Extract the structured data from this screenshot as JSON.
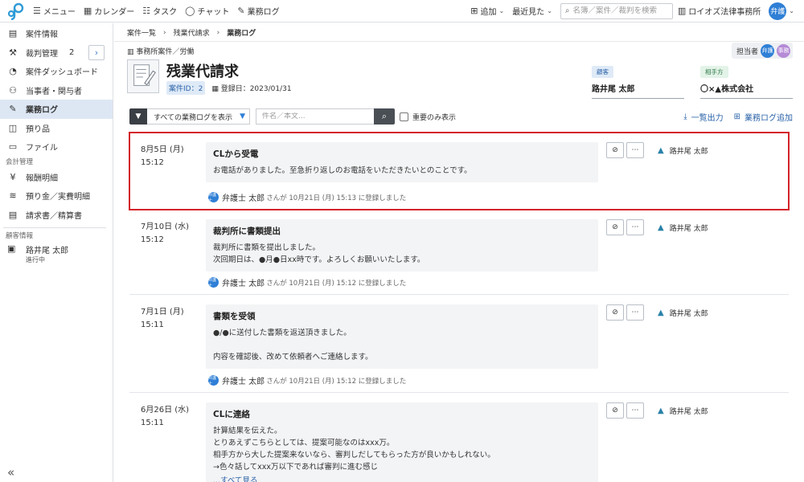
{
  "topbar": {
    "nav": [
      {
        "icon": "hamburger-icon",
        "glyph": "☰",
        "label": "メニュー"
      },
      {
        "icon": "calendar-icon",
        "glyph": "▦",
        "label": "カレンダー"
      },
      {
        "icon": "task-list-icon",
        "glyph": "☷",
        "label": "タスク"
      },
      {
        "icon": "chat-bubble-icon",
        "glyph": "◯",
        "label": "チャット"
      },
      {
        "icon": "business-log-icon",
        "glyph": "✎",
        "label": "業務ログ"
      }
    ],
    "add_label": "追加",
    "recent_label": "最近見た",
    "search_placeholder": "名簿／案件／裁判を検索",
    "office_name": "ロイオズ法律事務所",
    "user_avatar": "弁護"
  },
  "sidebar": {
    "items": [
      {
        "icon": "document-icon",
        "glyph": "▤",
        "label": "案件情報"
      },
      {
        "icon": "gavel-icon",
        "glyph": "⚒",
        "label": "裁判管理",
        "count": "2"
      },
      {
        "icon": "dashboard-icon",
        "glyph": "◔",
        "label": "案件ダッシュボード"
      },
      {
        "icon": "people-icon",
        "glyph": "⚇",
        "label": "当事者・関与者"
      },
      {
        "icon": "log-icon",
        "glyph": "✎",
        "label": "業務ログ",
        "active": true
      },
      {
        "icon": "box-icon",
        "glyph": "◫",
        "label": "預り品"
      },
      {
        "icon": "folder-icon",
        "glyph": "▭",
        "label": "ファイル"
      }
    ],
    "accounting_section": "会計管理",
    "accounting_items": [
      {
        "icon": "yen-icon",
        "glyph": "¥",
        "label": "報酬明細"
      },
      {
        "icon": "coins-icon",
        "glyph": "≋",
        "label": "預り金／実費明細"
      },
      {
        "icon": "invoice-icon",
        "glyph": "▤",
        "label": "請求書／精算書"
      }
    ],
    "client_section": "顧客情報",
    "client": {
      "name": "路井尾 太郎",
      "status": "進行中"
    }
  },
  "breadcrumb": [
    "案件一覧",
    "残業代請求",
    "業務ログ"
  ],
  "assignee": {
    "label": "担当者",
    "avatars": [
      {
        "text": "弁護",
        "color": "#2f7fd6"
      },
      {
        "text": "事務",
        "color": "#b58ad6"
      }
    ]
  },
  "case": {
    "type": "事務所案件／労働",
    "title": "残業代請求",
    "id": "案件ID：2",
    "registered": "登録日：2023/01/31"
  },
  "parties": {
    "client": {
      "tag": "顧客",
      "name": "路井尾 太郎",
      "tag_bg": "#dfeaf7",
      "tag_color": "#2a62a8"
    },
    "opponent": {
      "tag": "相手方",
      "name": "〇×▲株式会社",
      "tag_bg": "#e3f3e8",
      "tag_color": "#2f7a48"
    }
  },
  "filter": {
    "select_value": "すべての業務ログを表示",
    "search_placeholder": "件名／本文...",
    "important_only": "重要のみ表示"
  },
  "actions": {
    "export": "一覧出力",
    "add": "業務ログ追加"
  },
  "logs": [
    {
      "date": "8月5日 (月)",
      "time": "15:12",
      "title": "CLから受電",
      "body": "お電話がありました。至急折り返しのお電話をいただきたいとのことです。",
      "author": "弁護士 太郎",
      "registered": "さんが 10月21日 (月) 15:13 に登録しました",
      "person": "路井尾 太郎",
      "highlight": true
    },
    {
      "date": "7月10日 (水)",
      "time": "15:12",
      "title": "裁判所に書類提出",
      "body": "裁判所に書類を提出しました。\n次回期日は、●月●日xx時です。よろしくお願いいたします。",
      "author": "弁護士 太郎",
      "registered": "さんが 10月21日 (月) 15:12 に登録しました",
      "person": "路井尾 太郎"
    },
    {
      "date": "7月1日 (月)",
      "time": "15:11",
      "title": "書類を受領",
      "body": "●/●に送付した書類を返送頂きました。\n\n内容を確認後、改めて依頼者へご連絡します。",
      "author": "弁護士 太郎",
      "registered": "さんが 10月21日 (月) 15:12 に登録しました",
      "person": "路井尾 太郎"
    },
    {
      "date": "6月26日 (水)",
      "time": "15:11",
      "title": "CLに連絡",
      "body": "計算結果を伝えた。\nとりあえずこちらとしては、提案可能なのはxxx万。\n相手方から大した提案来ないなら、審判しだしてもらった方が良いかもしれない。\n→色々話してxxx万以下であれば審判に進む感じ",
      "more": "...すべて見る",
      "author": "",
      "registered": "",
      "person": "路井尾 太郎"
    }
  ],
  "author_avatar": "弁護士",
  "colors": {
    "accent": "#2f7fd6",
    "link": "#2a62a8",
    "highlight_border": "#d3232a",
    "active_bg": "#dde7f4"
  }
}
